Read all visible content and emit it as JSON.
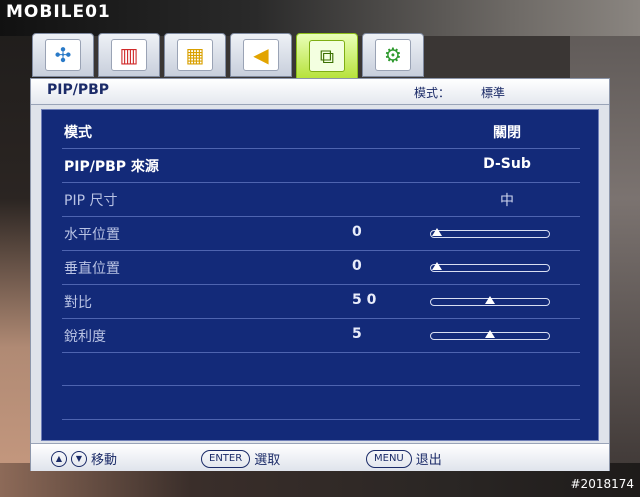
{
  "watermark": "MOBILE01",
  "photo_id": "#2018174",
  "tabs": [
    {
      "name": "picture",
      "icon": "picture-settings-icon",
      "glyph": "✣"
    },
    {
      "name": "color",
      "icon": "color-bars-icon",
      "glyph": "▥"
    },
    {
      "name": "advanced",
      "icon": "advanced-picture-icon",
      "glyph": "▦"
    },
    {
      "name": "audio",
      "icon": "speaker-icon",
      "glyph": "◀"
    },
    {
      "name": "pip",
      "icon": "pip-icon",
      "glyph": "⧉"
    },
    {
      "name": "system",
      "icon": "system-tools-icon",
      "glyph": "⚙"
    }
  ],
  "active_tab_index": 4,
  "header": {
    "title": "PIP/PBP",
    "mode_label": "模式：",
    "mode_value": "標準"
  },
  "rows": [
    {
      "label": "模式",
      "value": "關閉",
      "enabled": true
    },
    {
      "label": "PIP/PBP 來源",
      "value": "D-Sub",
      "enabled": true
    },
    {
      "label": "PIP 尺寸",
      "value": "中",
      "enabled": false
    },
    {
      "label": "水平位置",
      "number": "0",
      "level": 0,
      "enabled": false
    },
    {
      "label": "垂直位置",
      "number": "0",
      "level": 0,
      "enabled": false
    },
    {
      "label": "對比",
      "number": "5 0",
      "level": 50,
      "enabled": false
    },
    {
      "label": "銳利度",
      "number": "5",
      "level": 50,
      "enabled": false
    }
  ],
  "footer": {
    "move_label": "移動",
    "select_key": "ENTER",
    "select_label": "選取",
    "exit_key": "MENU",
    "exit_label": "退出"
  },
  "colors": {
    "osd_blue": "#132a79",
    "active_tab": "#b7e23c",
    "text_navy": "#1b2b68"
  }
}
